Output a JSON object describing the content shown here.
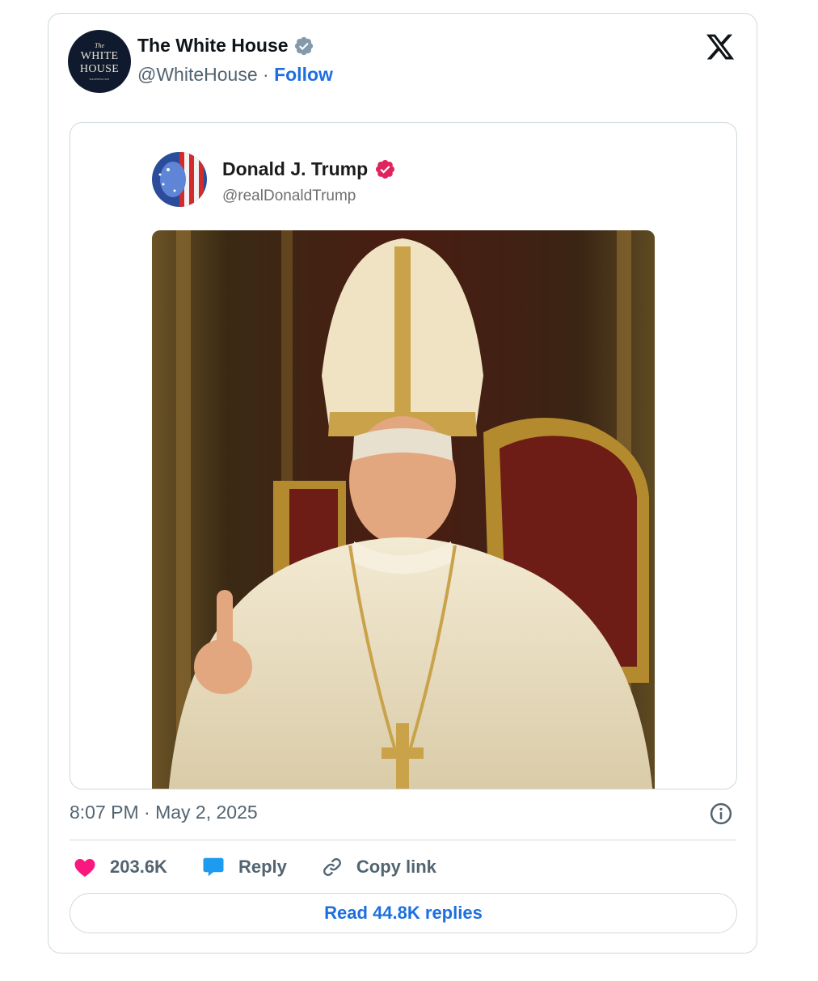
{
  "author": {
    "name": "The White House",
    "handle": "@WhiteHouse",
    "separator": "·",
    "follow_label": "Follow",
    "avatar_text": {
      "top": "The",
      "line1": "WHITE",
      "line2": "HOUSE",
      "bottom": "WASHINGTON"
    }
  },
  "platform_icon": "x-logo-icon",
  "embedded_post": {
    "name": "Donald J. Trump",
    "handle": "@realDonaldTrump",
    "badge_color": "#e0245e",
    "image_icon": "portrait-image"
  },
  "timestamp": "8:07 PM · May 2, 2025",
  "actions": {
    "like_count": "203.6K",
    "reply_label": "Reply",
    "copy_link_label": "Copy link"
  },
  "read_replies_label": "Read 44.8K replies",
  "colors": {
    "accent": "#1d6fe0",
    "like": "#f91880",
    "reply_bubble": "#1d9bf0",
    "verified_gray": "#829aab"
  }
}
